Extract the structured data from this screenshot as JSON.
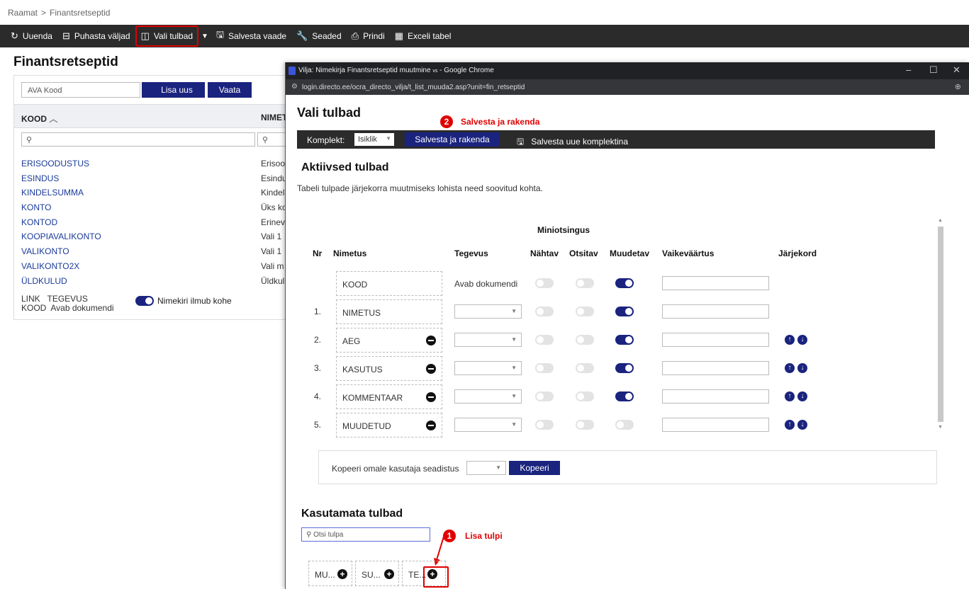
{
  "breadcrumb": {
    "root": "Raamat",
    "sep": ">",
    "current": "Finantsretseptid"
  },
  "toolbar": {
    "refresh": "Uuenda",
    "clear": "Puhasta väljad",
    "choose_columns": "Vali tulbad",
    "save_view": "Salvesta vaade",
    "settings": "Seaded",
    "print": "Prindi",
    "excel": "Exceli tabel"
  },
  "page": {
    "title": "Finantsretseptid",
    "search_placeholder": "AVA Kood",
    "add_new": "Lisa uus",
    "view": "Vaata",
    "col_code": "KOOD",
    "col_name": "NIMET",
    "rows": [
      {
        "code": "ERISOODUSTUS",
        "name": "Erisoo"
      },
      {
        "code": "ESINDUS",
        "name": "Esindu"
      },
      {
        "code": "KINDELSUMMA",
        "name": "Kindel"
      },
      {
        "code": "KONTO",
        "name": "Üks ko"
      },
      {
        "code": "KONTOD",
        "name": "Erinev"
      },
      {
        "code": "KOOPIAVALIKONTO",
        "name": "Vali 1"
      },
      {
        "code": "VALIKONTO",
        "name": "Vali 1"
      },
      {
        "code": "VALIKONTO2X",
        "name": "Vali m"
      },
      {
        "code": "ÜLDKULUD",
        "name": "Üldkul"
      }
    ],
    "footer_link": "LINK",
    "footer_action": "TEGEVUS",
    "footer_code": "KOOD",
    "footer_open": "Avab dokumendi",
    "toggle_label": "Nimekiri ilmub kohe"
  },
  "popup": {
    "window_title": "Vilja: Nimekirja Finantsretseptid muutmine",
    "window_suffix": "- Google Chrome",
    "url": "login.directo.ee/ocra_directo_vilja/t_list_muuda2.asp?unit=fin_retseptid",
    "heading": "Vali tulbad",
    "annotation2": {
      "num": "2",
      "text": "Salvesta ja rakenda"
    },
    "bar": {
      "set_label": "Komplekt:",
      "set_value": "Isiklik",
      "save_apply": "Salvesta ja rakenda",
      "save_new": "Salvesta uue komplektina"
    },
    "active_title": "Aktiivsed tulbad",
    "active_desc": "Tabeli tulpade järjekorra muutmiseks lohista need soovitud kohta.",
    "headers": {
      "group": "Miniotsingus",
      "nr": "Nr",
      "name": "Nimetus",
      "action": "Tegevus",
      "visible": "Nähtav",
      "searchable": "Otsitav",
      "editable": "Muudetav",
      "default": "Vaikeväärtus",
      "order": "Järjekord"
    },
    "rows": [
      {
        "nr": "",
        "name": "KOOD",
        "action": "Avab dokumendi",
        "editable": true,
        "removable": false,
        "order": false
      },
      {
        "nr": "1.",
        "name": "NIMETUS",
        "action": "",
        "editable": true,
        "removable": false,
        "order": false
      },
      {
        "nr": "2.",
        "name": "AEG",
        "action": "",
        "editable": true,
        "removable": true,
        "order": true
      },
      {
        "nr": "3.",
        "name": "KASUTUS",
        "action": "",
        "editable": true,
        "removable": true,
        "order": true
      },
      {
        "nr": "4.",
        "name": "KOMMENTAAR",
        "action": "",
        "editable": true,
        "removable": true,
        "order": true
      },
      {
        "nr": "5.",
        "name": "MUUDETUD",
        "action": "",
        "editable": false,
        "removable": true,
        "order": true
      }
    ],
    "copy_label": "Kopeeri omale kasutaja seadistus",
    "copy_button": "Kopeeri",
    "unused_title": "Kasutamata tulbad",
    "search_columns_placeholder": "Otsi tulpa",
    "annotation1": {
      "num": "1",
      "text": "Lisa tulpi"
    },
    "unused": [
      "MU...",
      "SU...",
      "TE..."
    ]
  },
  "colors": {
    "accent": "#1a237e",
    "highlight": "#e00000",
    "toolbar": "#2b2b2b"
  }
}
